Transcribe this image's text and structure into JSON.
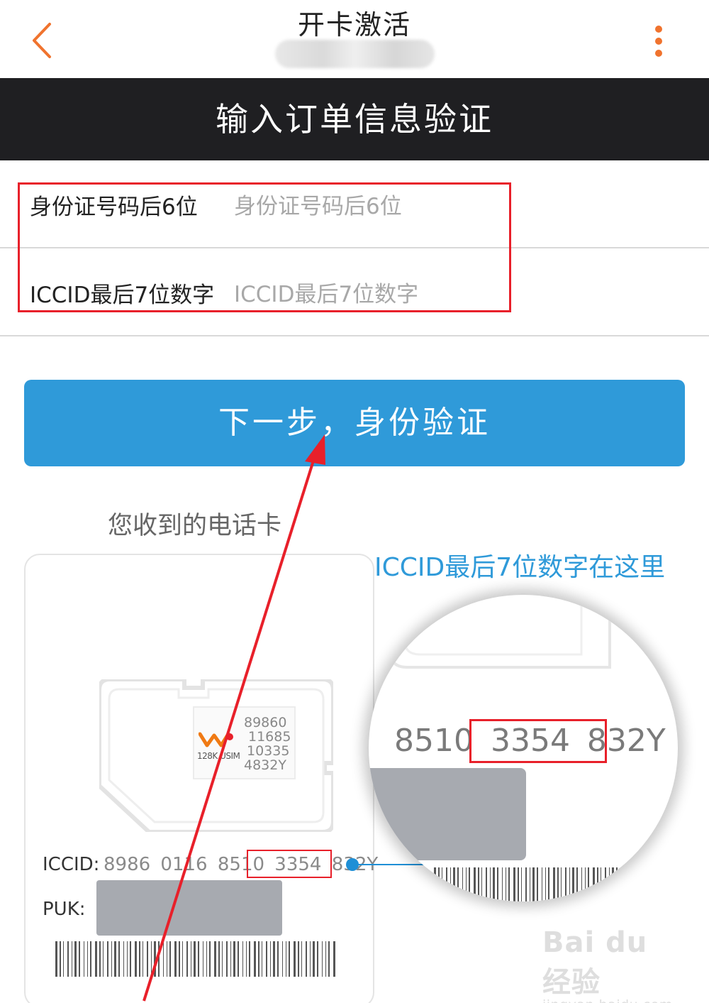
{
  "header": {
    "title": "开卡激活",
    "subtitle": "",
    "back_icon": "chevron-left-icon",
    "more_icon": "more-vertical-icon",
    "accent_color": "#f0732e"
  },
  "banner": {
    "title": "输入订单信息验证",
    "bg_color": "#1f1f22"
  },
  "form": {
    "id_last6": {
      "label": "身份证号码后6位",
      "placeholder": "身份证号码后6位",
      "value": ""
    },
    "iccid_last7": {
      "label": "ICCID最后7位数字",
      "placeholder": "ICCID最后7位数字",
      "value": ""
    },
    "highlight_color": "#e8202a"
  },
  "next_button": {
    "label": "下一步，身份验证",
    "color": "#2f9ad9"
  },
  "illustration": {
    "caption": "您收到的电话卡",
    "hint": "ICCID最后7位数字在这里",
    "chip_numbers": [
      "89860",
      "11685",
      "10335",
      "4832Y"
    ],
    "chip_brand": "128K USIM",
    "iccid_label": "ICCID:",
    "iccid_value": "8986 0116 8510 3354 832Y",
    "puk_label": "PUK:",
    "magnified_value": "8510 3354 832Y"
  },
  "watermark": {
    "main": "Bai du 经验",
    "sub": "jingyan.baidu.com"
  }
}
